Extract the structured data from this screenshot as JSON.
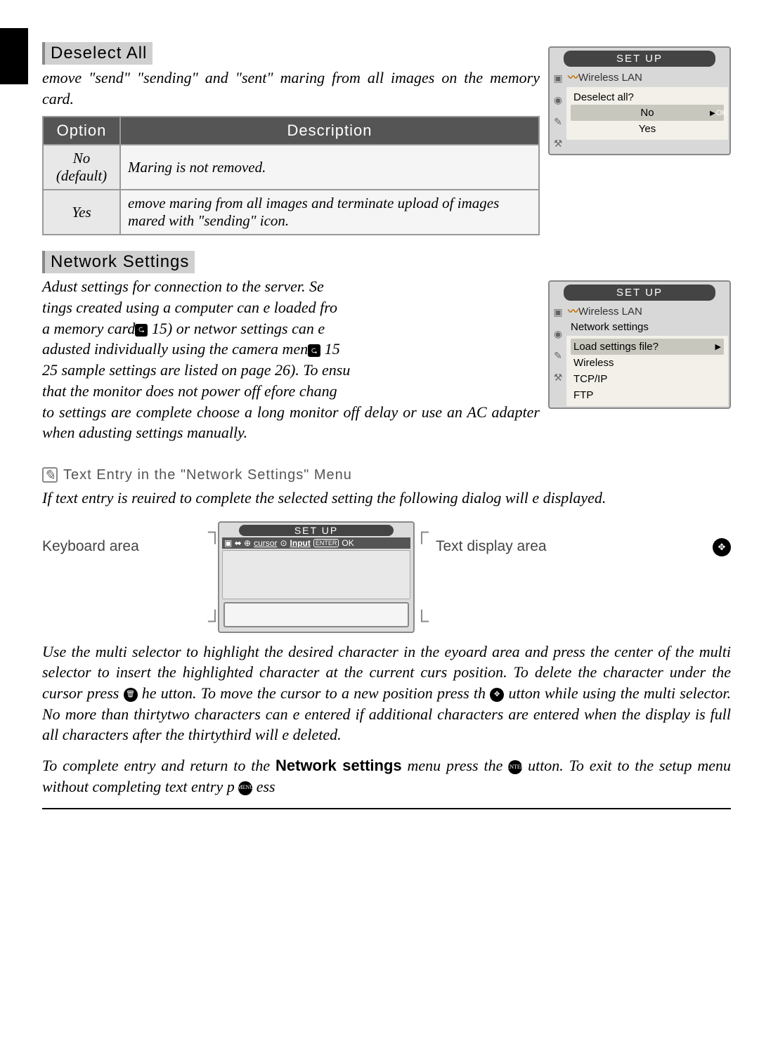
{
  "section1": {
    "heading": "Deselect All",
    "intro": "emove \"send\" \"sending\" and \"sent\" maring from all images on the memory card."
  },
  "table": {
    "h_option": "Option",
    "h_desc": "Description",
    "r1_opt": "No (default)",
    "r1_desc": "Maring is not removed.",
    "r2_opt": "Yes",
    "r2_desc": "emove maring from all images and terminate upload of images mared with \"sending\" icon."
  },
  "cam1": {
    "title": "SET UP",
    "bread": "Wireless LAN",
    "prompt": "Deselect all?",
    "no": "No",
    "ok": "OK",
    "yes": "Yes"
  },
  "section2": {
    "heading": "Network Settings",
    "body_a": "Adust settings for connection to the server.  Se",
    "body_b": "tings created using a computer can e loaded fro",
    "body_c": "a memory card",
    "body_c2": " 15) or networ settings can e ",
    "body_d": "adusted individually using the camera men",
    "body_d2": " 15",
    "body_e": "25 sample settings are listed on page 26).  To ensu",
    "body_f": "that the monitor does not power off efore chang",
    "body_g": "to settings are complete choose a long monitor off delay or use an AC adapter when adusting settings manually."
  },
  "cam2": {
    "title": "SET UP",
    "bread": "Wireless LAN",
    "sub": "Network settings",
    "load": "Load settings file?",
    "wireless": "Wireless",
    "tcpip": "TCP/IP",
    "ftp": "FTP"
  },
  "note": {
    "heading": "Text Entry in the \"Network Settings\" Menu",
    "intro": "If text entry is reuired to complete the selected setting the following dialog will e displayed."
  },
  "entry": {
    "kb_label": "Keyboard area",
    "txt_label": "Text display area",
    "title": "SET UP",
    "bar_cursor": "cursor",
    "bar_input": "Input",
    "bar_ok": "OK"
  },
  "para2": "Use the multi selector to highlight the desired character in the eyoard area and press the center of the multi selector to insert the highlighted character at the current curs position.  To delete the character under the cursor press",
  "para2b": "he utton.  To move the cursor to a new position press th",
  "para2c": " utton while using the multi selector.  No more than thirtytwo characters can e entered if additional characters are entered when the display is full all characters after the thirtythird will e deleted.",
  "para3a": "To complete entry and return to t",
  "para3b": "he ",
  "para3c": "Network settings",
  "para3d": " menu press the",
  "para3e": " utton.  To exit to the setup menu without completing text entry p",
  "para3f": "ess"
}
